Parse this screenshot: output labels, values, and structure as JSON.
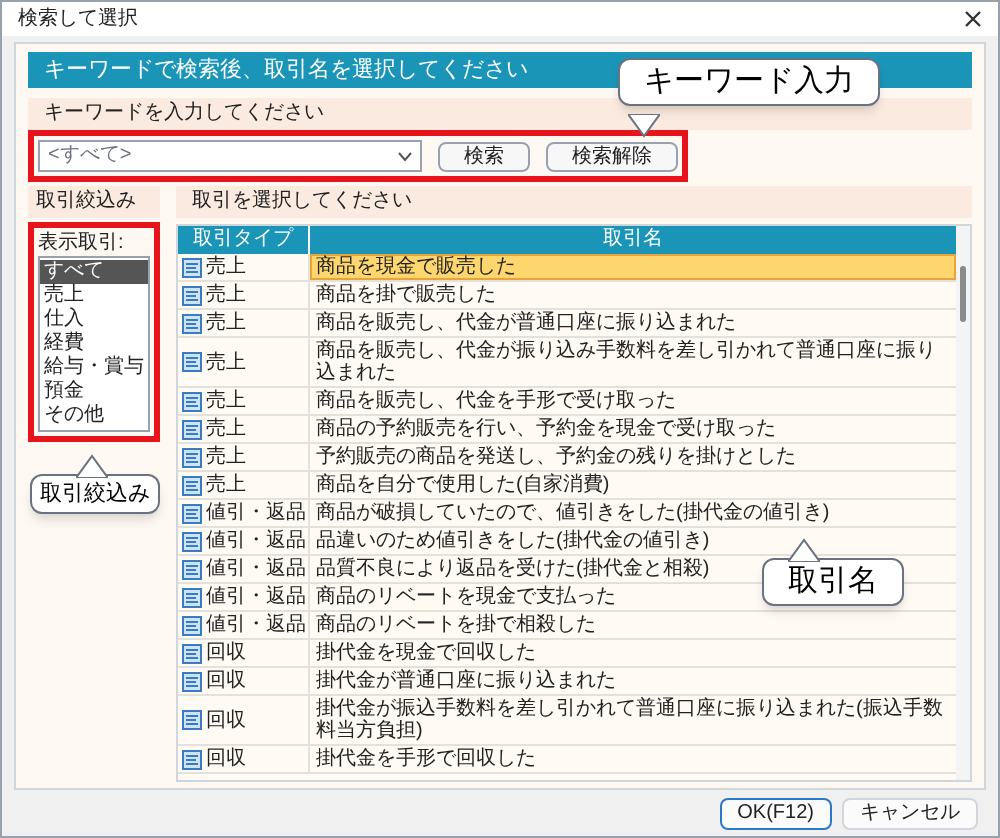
{
  "window": {
    "title": "検索して選択"
  },
  "banner": "キーワードで検索後、取引名を選択してください",
  "keyword": {
    "label": "キーワードを入力してください",
    "value": "<すべて>",
    "buttons": [
      "検索",
      "検索解除"
    ]
  },
  "filter": {
    "heading": "取引絞込み",
    "label": "表示取引:",
    "items": [
      {
        "label": "すべて",
        "selected": true
      },
      {
        "label": "売上",
        "selected": false
      },
      {
        "label": "仕入",
        "selected": false
      },
      {
        "label": "経費",
        "selected": false
      },
      {
        "label": "給与・賞与",
        "selected": false
      },
      {
        "label": "預金",
        "selected": false
      },
      {
        "label": "その他",
        "selected": false
      }
    ]
  },
  "table": {
    "heading": "取引を選択してください",
    "columns": [
      "取引タイプ",
      "取引名"
    ],
    "rows": [
      {
        "type": "売上",
        "name": "商品を現金で販売した",
        "selected": true
      },
      {
        "type": "売上",
        "name": "商品を掛で販売した",
        "selected": false
      },
      {
        "type": "売上",
        "name": "商品を販売し、代金が普通口座に振り込まれた",
        "selected": false
      },
      {
        "type": "売上",
        "name": "商品を販売し、代金が振り込み手数料を差し引かれて普通口座に振り込まれた",
        "selected": false
      },
      {
        "type": "売上",
        "name": "商品を販売し、代金を手形で受け取った",
        "selected": false
      },
      {
        "type": "売上",
        "name": "商品の予約販売を行い、予約金を現金で受け取った",
        "selected": false
      },
      {
        "type": "売上",
        "name": "予約販売の商品を発送し、予約金の残りを掛けとした",
        "selected": false
      },
      {
        "type": "売上",
        "name": "商品を自分で使用した(自家消費)",
        "selected": false
      },
      {
        "type": "値引・返品",
        "name": "商品が破損していたので、値引きをした(掛代金の値引き)",
        "selected": false
      },
      {
        "type": "値引・返品",
        "name": "品違いのため値引きをした(掛代金の値引き)",
        "selected": false
      },
      {
        "type": "値引・返品",
        "name": "品質不良により返品を受けた(掛代金と相殺)",
        "selected": false
      },
      {
        "type": "値引・返品",
        "name": "商品のリベートを現金で支払った",
        "selected": false
      },
      {
        "type": "値引・返品",
        "name": "商品のリベートを掛で相殺した",
        "selected": false
      },
      {
        "type": "回収",
        "name": "掛代金を現金で回収した",
        "selected": false
      },
      {
        "type": "回収",
        "name": "掛代金が普通口座に振り込まれた",
        "selected": false
      },
      {
        "type": "回収",
        "name": "掛代金が振込手数料を差し引かれて普通口座に振り込まれた(振込手数料当方負担)",
        "selected": false
      },
      {
        "type": "回収",
        "name": "掛代金を手形で回収した",
        "selected": false
      }
    ]
  },
  "footer_buttons": [
    "OK(F12)",
    "キャンセル"
  ],
  "callouts": [
    "キーワード入力",
    "取引絞込み",
    "取引名"
  ]
}
